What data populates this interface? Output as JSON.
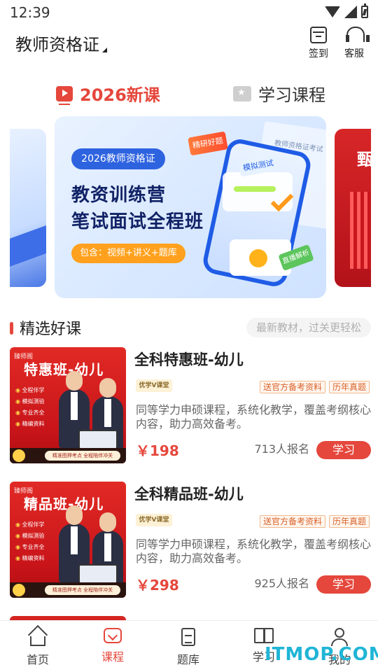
{
  "status_bar": {
    "time": "12:39"
  },
  "header": {
    "title": "教师资格证",
    "checkin_label": "签到",
    "service_label": "客服"
  },
  "tabs": [
    {
      "label": "2026新课",
      "active": true
    },
    {
      "label": "学习课程",
      "active": false
    }
  ],
  "banner": {
    "pill": "2026教师资格证",
    "line1": "教资训练营",
    "line2": "笔试面试全程班",
    "tag": "包含：视频+讲义+题库",
    "badge_jingyan": "精研好题",
    "badge_mock": "模拟测试",
    "badge_live": "直播解析",
    "paper_title": "教师资格证考试",
    "right_peek_text": "甄"
  },
  "section": {
    "title": "精选好课",
    "hint": "最新教材，过关更轻松"
  },
  "courses": [
    {
      "title": "全科特惠班-幼儿",
      "thumb_logo": "臻师阁",
      "thumb_title": "特惠班-幼儿",
      "thumb_items": [
        "全程伴学",
        "模拟测验",
        "专业齐全",
        "精编资料"
      ],
      "thumb_footer": "精准图押考点 全程陪伴冲关",
      "brand": "优学V课堂",
      "tags": [
        "送官方备考资料",
        "历年真题"
      ],
      "desc": "同等学力申硕课程，系统化教学，覆盖考纲核心内容，助力高效备考。",
      "price": "￥198",
      "signup": "713人报名",
      "button": "学习"
    },
    {
      "title": "全科精品班-幼儿",
      "thumb_logo": "臻师阁",
      "thumb_title": "精品班-幼儿",
      "thumb_items": [
        "全程伴学",
        "模拟测验",
        "专业齐全",
        "精编资料"
      ],
      "thumb_footer": "精准图押考点 全程陪伴冲关",
      "brand": "优学V课堂",
      "tags": [
        "送官方备考资料",
        "历年真题"
      ],
      "desc": "同等学力申硕课程，系统化教学，覆盖考纲核心内容，助力高效备考。",
      "price": "￥298",
      "signup": "925人报名",
      "button": "学习"
    }
  ],
  "bottom_nav": [
    {
      "label": "首页",
      "icon": "home-icon",
      "active": false
    },
    {
      "label": "课程",
      "icon": "course-icon",
      "active": true
    },
    {
      "label": "题库",
      "icon": "question-bank-icon",
      "active": false
    },
    {
      "label": "学习",
      "icon": "book-icon",
      "active": false
    },
    {
      "label": "我的",
      "icon": "user-icon",
      "active": false
    }
  ],
  "watermark": "ITMOP.COM",
  "colors": {
    "accent": "#e5473c",
    "banner_blue": "#2e63e0"
  }
}
